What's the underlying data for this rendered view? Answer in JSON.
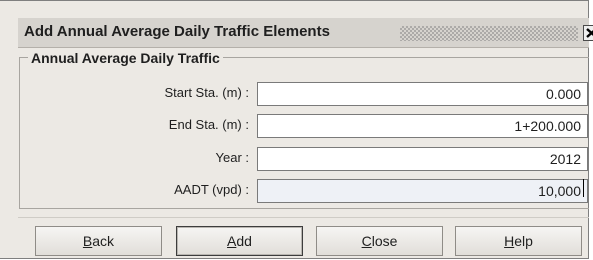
{
  "window": {
    "title": "Add Annual Average Daily Traffic Elements"
  },
  "group": {
    "title": "Annual Average Daily Traffic"
  },
  "fields": [
    {
      "label": "Start Sta. (m) :",
      "value": "0.000"
    },
    {
      "label": "End Sta. (m) :",
      "value": "1+200.000"
    },
    {
      "label": "Year :",
      "value": "2012"
    },
    {
      "label": "AADT (vpd) :",
      "value": "10,000"
    }
  ],
  "buttons": [
    {
      "mnemonic": "B",
      "rest": "ack"
    },
    {
      "mnemonic": "A",
      "rest": "dd"
    },
    {
      "mnemonic": "C",
      "rest": "lose"
    },
    {
      "mnemonic": "H",
      "rest": "elp"
    }
  ],
  "icons": {
    "close": "close-icon"
  }
}
